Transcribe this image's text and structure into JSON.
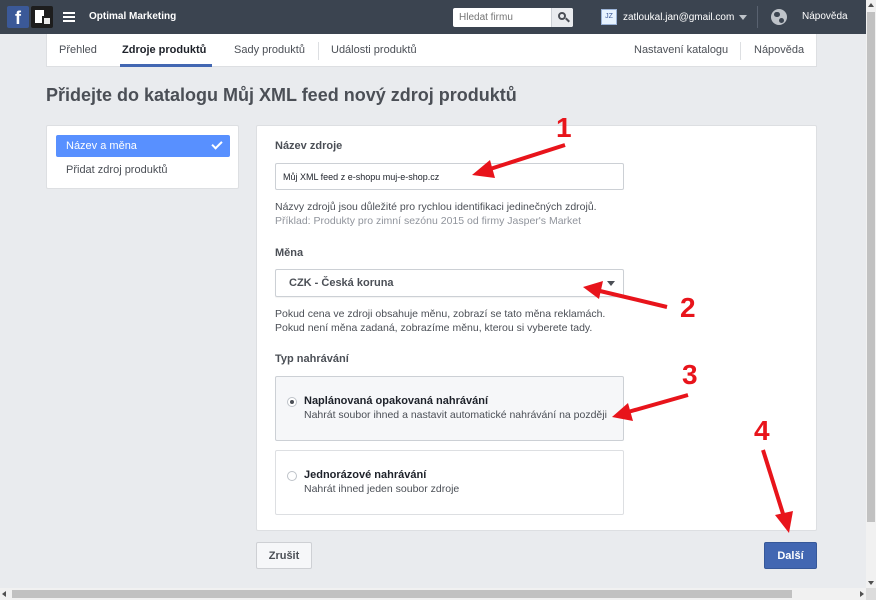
{
  "topbar": {
    "brand": "Optimal Marketing",
    "search_placeholder": "Hledat firmu",
    "avatar_initials": "JZ",
    "user_email": "zatloukal.jan@gmail.com",
    "help": "Nápověda"
  },
  "tabs": {
    "items": [
      "Přehled",
      "Zdroje produktů",
      "Sady produktů",
      "Události produktů"
    ],
    "right": [
      "Nastavení katalogu",
      "Nápověda"
    ]
  },
  "page_title": "Přidejte do katalogu Můj XML feed nový zdroj produktů",
  "leftnav": {
    "items": [
      "Název a měna",
      "Přidat zdroj produktů"
    ]
  },
  "form": {
    "name_label": "Název zdroje",
    "name_value": "Můj XML feed z e-shopu muj-e-shop.cz",
    "name_hint": "Názvy zdrojů jsou důležité pro rychlou identifikaci jedinečných zdrojů.",
    "name_example": "Příklad: Produkty pro zimní sezónu 2015 od firmy Jasper's Market",
    "currency_label": "Měna",
    "currency_value": "CZK - Česká koruna",
    "currency_hint_1": "Pokud cena ve zdroji obsahuje měnu, zobrazí se tato měna reklamách.",
    "currency_hint_2": "Pokud není měna zadaná, zobrazíme měnu, kterou si vyberete tady.",
    "upload_label": "Typ nahrávání",
    "upload_options": [
      {
        "title": "Naplánovaná opakovaná nahrávání",
        "desc": "Nahrát soubor ihned a nastavit automatické nahrávání na později",
        "selected": true
      },
      {
        "title": "Jednorázové nahrávání",
        "desc": "Nahrát ihned jeden soubor zdroje",
        "selected": false
      }
    ]
  },
  "actions": {
    "cancel": "Zrušit",
    "next": "Další"
  },
  "annotations": {
    "numbers": [
      "1",
      "2",
      "3",
      "4"
    ],
    "color": "#e8141b"
  },
  "colors": {
    "topbar": "#3b4450",
    "accent": "#4267b2",
    "nav_active": "#5890ff"
  }
}
